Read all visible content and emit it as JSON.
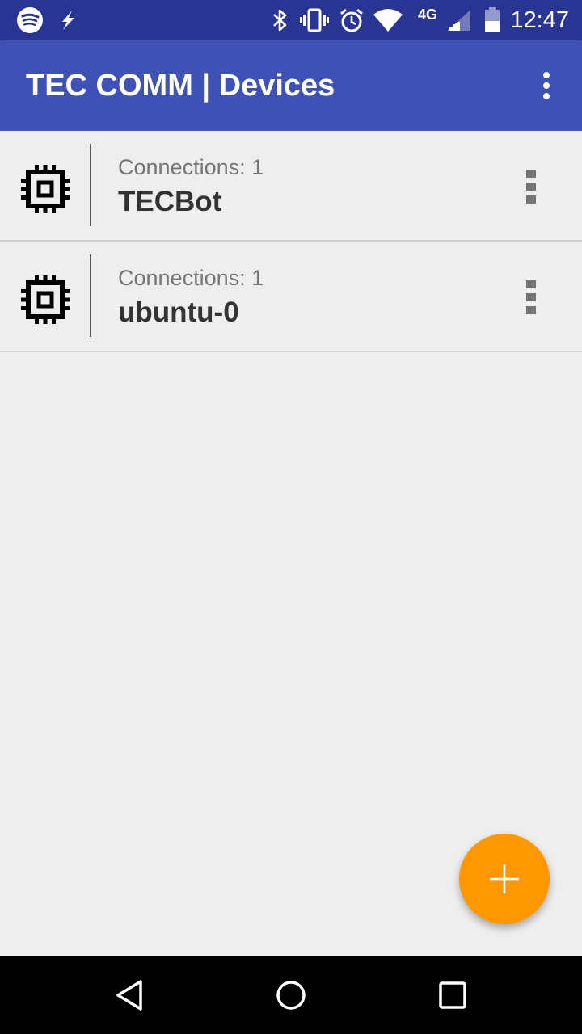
{
  "status_bar": {
    "time": "12:47",
    "network_label": "4G",
    "icons": [
      "spotify-icon",
      "flash-icon",
      "bluetooth-icon",
      "vibrate-icon",
      "alarm-icon",
      "wifi-icon",
      "lte-icon",
      "signal-icon",
      "battery-icon"
    ]
  },
  "app_bar": {
    "title": "TEC COMM | Devices",
    "overflow_icon": "more-vert-icon"
  },
  "devices": [
    {
      "connections": "Connections: 1",
      "name": "TECBot",
      "icon": "chip-icon",
      "menu_icon": "more-vert-icon"
    },
    {
      "connections": "Connections: 1",
      "name": "ubuntu-0",
      "icon": "chip-icon",
      "menu_icon": "more-vert-icon"
    }
  ],
  "fab": {
    "icon": "plus-icon"
  },
  "nav_bar": {
    "icons": [
      "back-icon",
      "home-icon",
      "recents-icon"
    ]
  },
  "colors": {
    "status_bar": "#283593",
    "app_bar": "#3f51b5",
    "fab": "#ff9800",
    "background": "#eeeeee"
  }
}
